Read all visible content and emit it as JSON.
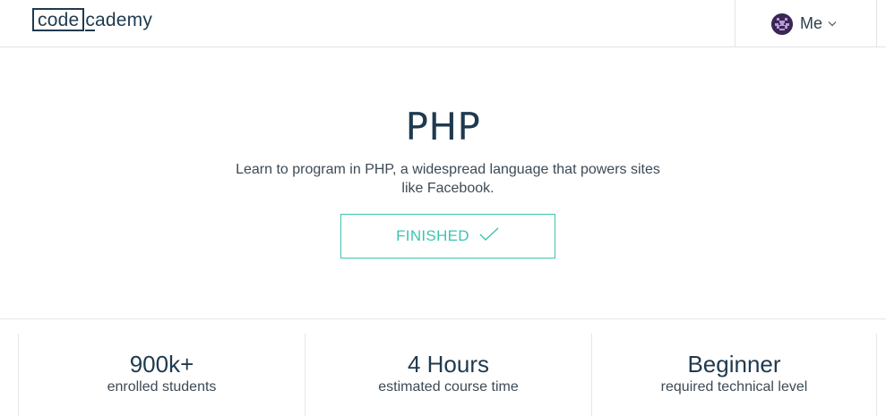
{
  "header": {
    "logo": {
      "box_text": "code",
      "rest_first": "c",
      "rest_tail": "ademy"
    },
    "user_menu": {
      "label": "Me",
      "avatar_icon": "pixel-avatar-icon",
      "dropdown_icon": "chevron-down-icon"
    }
  },
  "course": {
    "title": "PHP",
    "description": "Learn to program in PHP, a widespread language that powers sites like Facebook.",
    "status_button": {
      "label": "FINISHED",
      "icon": "check-icon"
    }
  },
  "stats": [
    {
      "value": "900k+",
      "label": "enrolled students"
    },
    {
      "value": "4 Hours",
      "label": "estimated course time"
    },
    {
      "value": "Beginner",
      "label": "required technical level"
    }
  ],
  "colors": {
    "brand_dark": "#1f3a4f",
    "accent_teal": "#3cc4b0",
    "border": "#e6e6e6",
    "body_text": "#3d4a55"
  }
}
